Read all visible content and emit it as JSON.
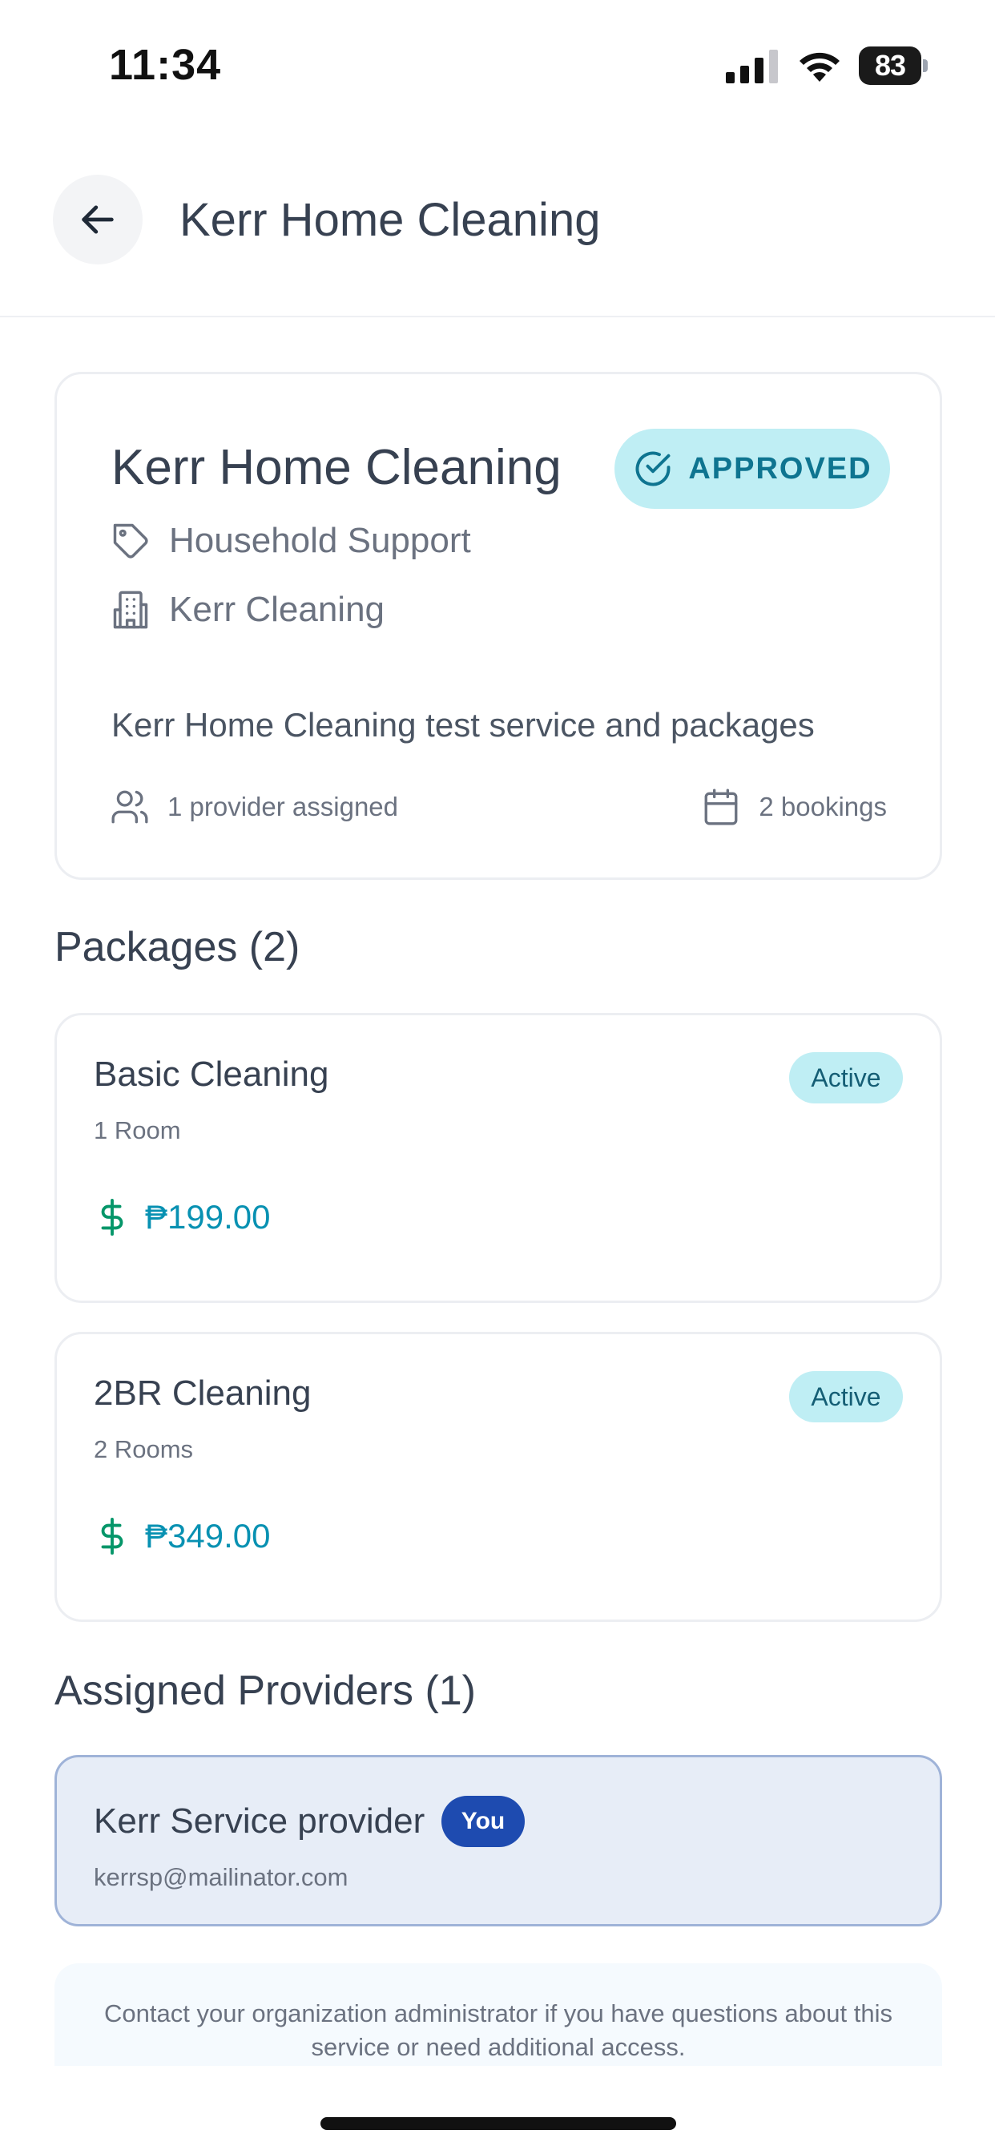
{
  "status_bar": {
    "time": "11:34",
    "battery": "83"
  },
  "header": {
    "title": "Kerr Home Cleaning"
  },
  "service": {
    "title": "Kerr Home Cleaning",
    "status": "APPROVED",
    "category": "Household Support",
    "organization": "Kerr Cleaning",
    "description": "Kerr Home Cleaning test service and packages",
    "providers_assigned": "1 provider assigned",
    "bookings": "2 bookings"
  },
  "packages": {
    "title": "Packages (2)",
    "items": [
      {
        "name": "Basic Cleaning",
        "rooms": "1 Room",
        "status": "Active",
        "price": "₱199.00"
      },
      {
        "name": "2BR Cleaning",
        "rooms": "2 Rooms",
        "status": "Active",
        "price": "₱349.00"
      }
    ]
  },
  "providers": {
    "title": "Assigned Providers (1)",
    "items": [
      {
        "name": "Kerr Service provider",
        "badge": "You",
        "email": "kerrsp@mailinator.com"
      }
    ]
  },
  "note": "Contact your organization administrator if you have questions about this service or need additional access.",
  "colors": {
    "accent_cyan": "#bfeef4",
    "price_green": "#059669",
    "price_cyan": "#0891b2",
    "you_badge": "#1e4bb0",
    "provider_card": "#e7edf7"
  },
  "icons": {
    "back": "arrow-left-icon",
    "approved": "check-circle-icon",
    "category": "tag-icon",
    "organization": "building-icon",
    "providers": "users-icon",
    "bookings": "calendar-icon",
    "price": "dollar-icon"
  }
}
